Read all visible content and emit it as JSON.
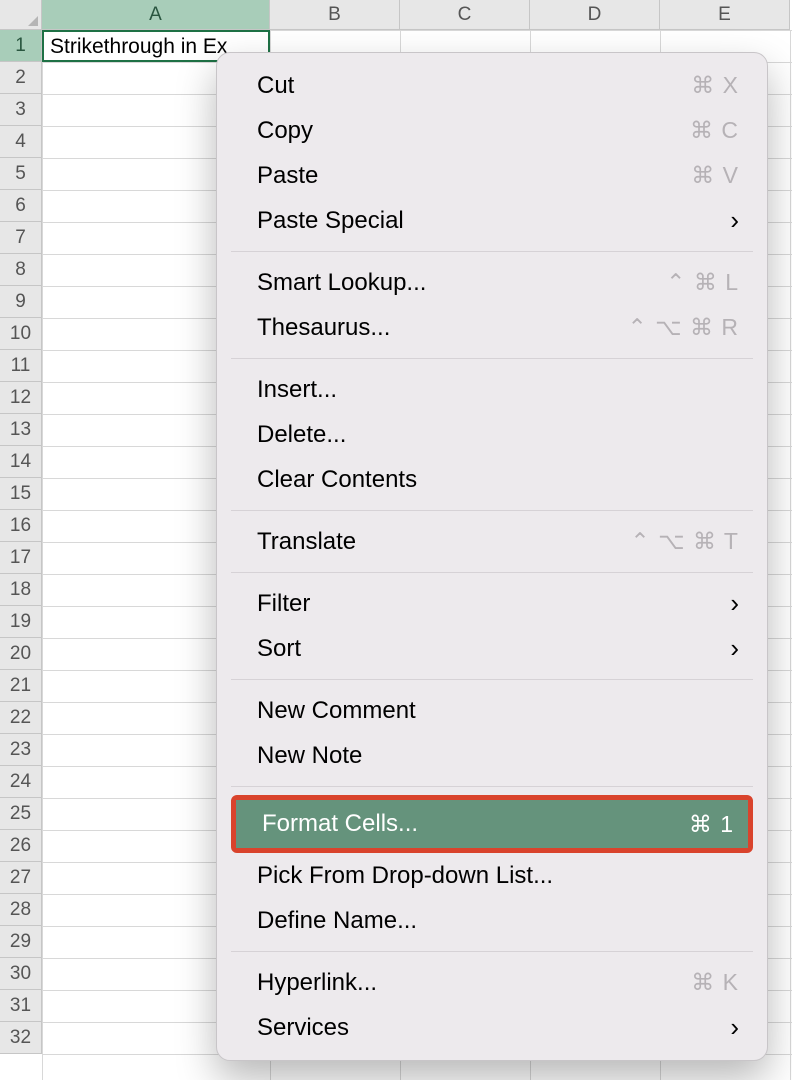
{
  "columns": [
    "A",
    "B",
    "C",
    "D",
    "E"
  ],
  "rows_count": 32,
  "cell_A1": "Strikethrough in Ex",
  "menu": {
    "cut": "Cut",
    "cut_sc": "⌘ X",
    "copy": "Copy",
    "copy_sc": "⌘ C",
    "paste": "Paste",
    "paste_sc": "⌘ V",
    "paste_special": "Paste Special",
    "smart_lookup": "Smart Lookup...",
    "smart_lookup_sc": "⌃ ⌘ L",
    "thesaurus": "Thesaurus...",
    "thesaurus_sc": "⌃ ⌥ ⌘ R",
    "insert": "Insert...",
    "delete": "Delete...",
    "clear": "Clear Contents",
    "translate": "Translate",
    "translate_sc": "⌃ ⌥ ⌘ T",
    "filter": "Filter",
    "sort": "Sort",
    "new_comment": "New Comment",
    "new_note": "New Note",
    "format_cells": "Format Cells...",
    "format_cells_sc": "⌘ 1",
    "pick_list": "Pick From Drop-down List...",
    "define_name": "Define Name...",
    "hyperlink": "Hyperlink...",
    "hyperlink_sc": "⌘ K",
    "services": "Services"
  },
  "chevron": "›"
}
